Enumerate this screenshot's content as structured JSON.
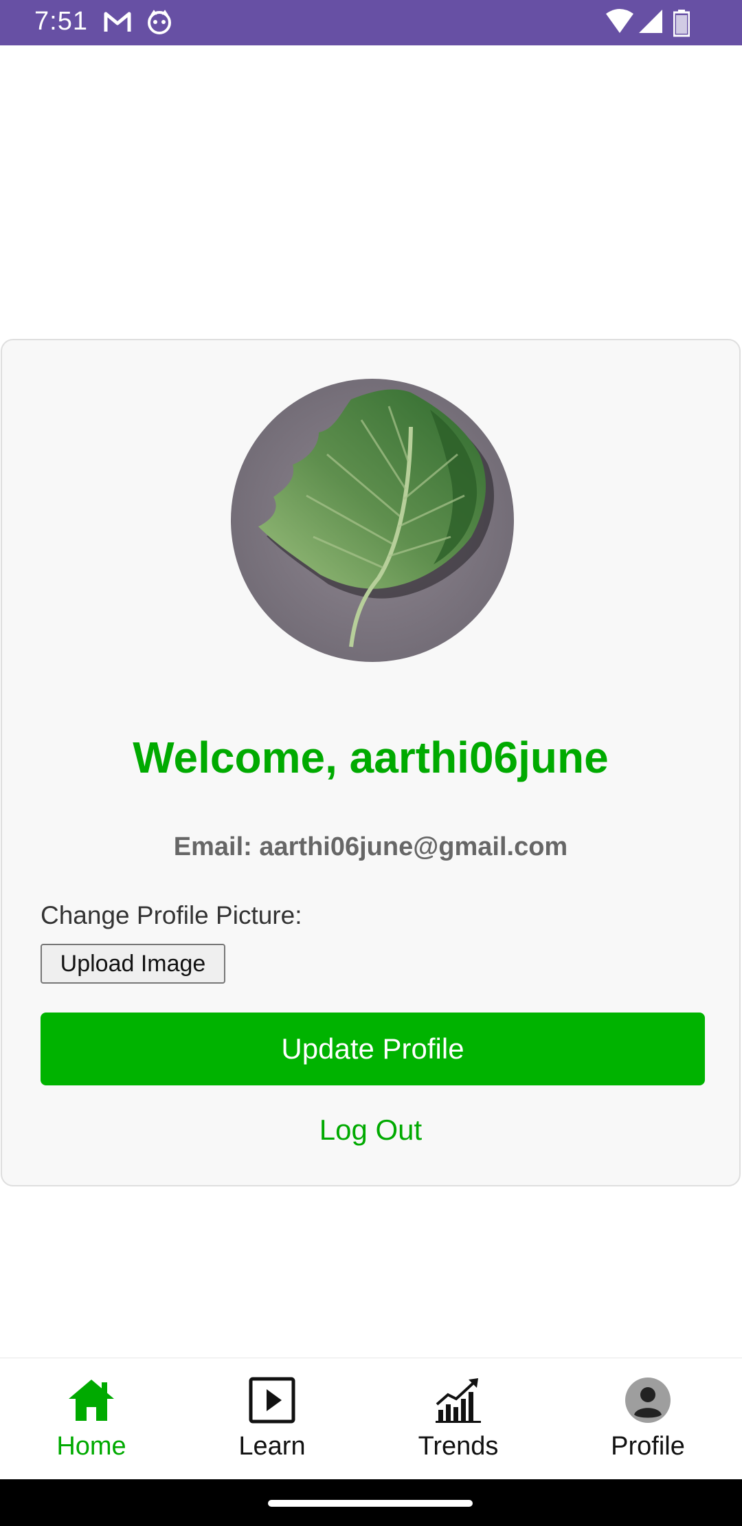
{
  "status_bar": {
    "time": "7:51",
    "icons": [
      "gmail-icon",
      "assistant-icon",
      "wifi-icon",
      "signal-icon",
      "battery-icon"
    ],
    "color": "#6750a4"
  },
  "profile": {
    "avatar": "leaf-photo",
    "welcome": "Welcome, aarthi06june",
    "email": "Email: aarthi06june@gmail.com",
    "change_label": "Change Profile Picture:",
    "upload_label": "Upload Image",
    "update_label": "Update Profile",
    "logout_label": "Log Out",
    "accent_color": "#00b300"
  },
  "nav": {
    "items": [
      {
        "label": "Home",
        "icon": "home-icon",
        "active": true
      },
      {
        "label": "Learn",
        "icon": "play-icon",
        "active": false
      },
      {
        "label": "Trends",
        "icon": "trends-icon",
        "active": false
      },
      {
        "label": "Profile",
        "icon": "profile-icon",
        "active": false
      }
    ]
  }
}
